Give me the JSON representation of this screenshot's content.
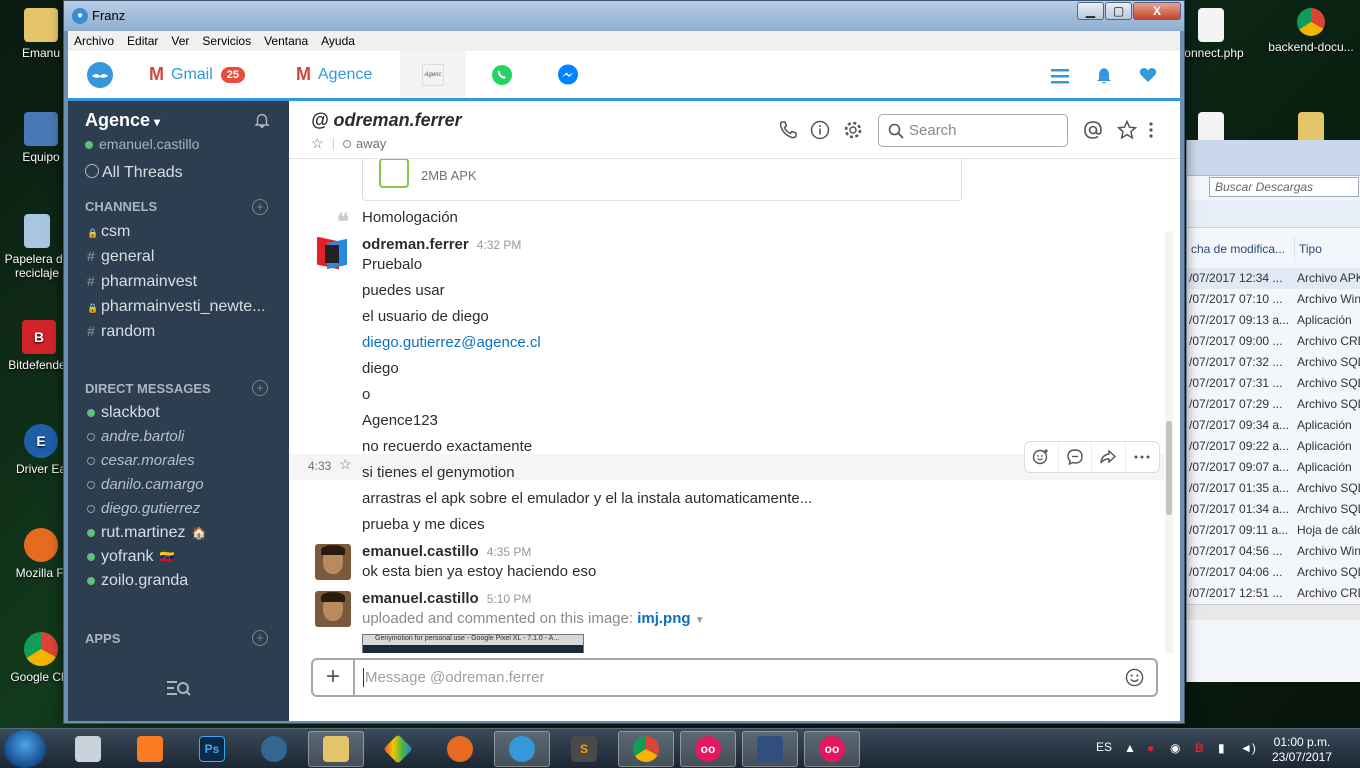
{
  "desktop": {
    "left_icons": [
      "Emanu",
      "Equipo",
      "Papelera de reciclaje",
      "Bitdefender",
      "Driver Ea",
      "Mozilla Fi",
      "Google Chr"
    ],
    "right_icons": [
      "connect.php",
      "backend-docu..."
    ]
  },
  "explorer": {
    "search_placeholder": "Buscar Descargas",
    "col_date": "cha de modifica...",
    "col_type": "Tipo",
    "rows": [
      {
        "date": "/07/2017 12:34 ...",
        "type": "Archivo APK"
      },
      {
        "date": "/07/2017 07:10 ...",
        "type": "Archivo Win"
      },
      {
        "date": "/07/2017 09:13 a...",
        "type": "Aplicación"
      },
      {
        "date": "/07/2017 09:00 ...",
        "type": "Archivo CRD"
      },
      {
        "date": "/07/2017 07:32 ...",
        "type": "Archivo SQL"
      },
      {
        "date": "/07/2017 07:31 ...",
        "type": "Archivo SQL"
      },
      {
        "date": "/07/2017 07:29 ...",
        "type": "Archivo SQL"
      },
      {
        "date": "/07/2017 09:34 a...",
        "type": "Aplicación"
      },
      {
        "date": "/07/2017 09:22 a...",
        "type": "Aplicación"
      },
      {
        "date": "/07/2017 09:07 a...",
        "type": "Aplicación"
      },
      {
        "date": "/07/2017 01:35 a...",
        "type": "Archivo SQL"
      },
      {
        "date": "/07/2017 01:34 a...",
        "type": "Archivo SQL"
      },
      {
        "date": "/07/2017 09:11 a...",
        "type": "Hoja de cálc"
      },
      {
        "date": "/07/2017 04:56 ...",
        "type": "Archivo Win"
      },
      {
        "date": "/07/2017 04:06 ...",
        "type": "Archivo SQL"
      },
      {
        "date": "/07/2017 12:51 ...",
        "type": "Archivo CRD"
      }
    ]
  },
  "window": {
    "title": "Franz",
    "minimize": "▁",
    "maximize": "▢",
    "close": "X"
  },
  "menu": [
    "Archivo",
    "Editar",
    "Ver",
    "Servicios",
    "Ventana",
    "Ayuda"
  ],
  "tabs": {
    "gmail_label": "Gmail",
    "gmail_badge": "25",
    "agence_label": "Agence",
    "agence_logo": "Agenc"
  },
  "sidebar": {
    "team": "Agence",
    "user": "emanuel.castillo",
    "all_threads": "All Threads",
    "channels_title": "CHANNELS",
    "channels": [
      {
        "prefix": "🔒",
        "name": "csm"
      },
      {
        "prefix": "#",
        "name": "general"
      },
      {
        "prefix": "#",
        "name": "pharmainvest"
      },
      {
        "prefix": "🔒",
        "name": "pharmainvesti_newte..."
      },
      {
        "prefix": "#",
        "name": "random"
      }
    ],
    "dm_title": "DIRECT MESSAGES",
    "dms": [
      {
        "name": "slackbot",
        "status": "on",
        "emoji": ""
      },
      {
        "name": "andre.bartoli",
        "status": "off",
        "emoji": ""
      },
      {
        "name": "cesar.morales",
        "status": "off",
        "emoji": ""
      },
      {
        "name": "danilo.camargo",
        "status": "off",
        "emoji": ""
      },
      {
        "name": "diego.gutierrez",
        "status": "off",
        "emoji": ""
      },
      {
        "name": "rut.martinez",
        "status": "on",
        "emoji": "🏠"
      },
      {
        "name": "yofrank",
        "status": "on",
        "emoji": "🇻🇪"
      },
      {
        "name": "zoilo.granda",
        "status": "on",
        "emoji": ""
      }
    ],
    "apps_title": "APPS"
  },
  "header": {
    "channel": "@ odreman.ferrer",
    "presence": "away",
    "search_placeholder": "Search"
  },
  "messages": {
    "file_size": "2MB APK",
    "quote": "Homologación",
    "block1": {
      "author": "odreman.ferrer",
      "time": "4:32 PM",
      "lines": [
        "Pruebalo",
        "puedes usar",
        "el usuario de diego",
        "diego.gutierrez@agence.cl",
        "diego",
        "o",
        "Agence123",
        "no recuerdo exactamente"
      ]
    },
    "hover_time": "4:33",
    "cont_lines": [
      "si tienes el genymotion",
      "arrastras el apk sobre el emulador y el la instala automaticamente...",
      "prueba y me dices"
    ],
    "block2": {
      "author": "emanuel.castillo",
      "time": "4:35 PM",
      "text": "ok esta bien ya estoy haciendo eso"
    },
    "block3": {
      "author": "emanuel.castillo",
      "time": "5:10 PM",
      "text": "uploaded and commented on this image:",
      "file": "imj.png"
    },
    "thumb_title": "Genymotion for personal use - Google Pixel XL - 7.1.0 - A..."
  },
  "composer": {
    "placeholder": "Message @odreman.ferrer",
    "plus": "+"
  },
  "taskbar": {
    "lang": "ES",
    "time": "01:00 p.m.",
    "date": "23/07/2017"
  },
  "colors": {
    "accent": "#3498db",
    "sidebar": "#2c3e50",
    "presence_on": "#5bc17b",
    "link": "#0b6fc7"
  }
}
